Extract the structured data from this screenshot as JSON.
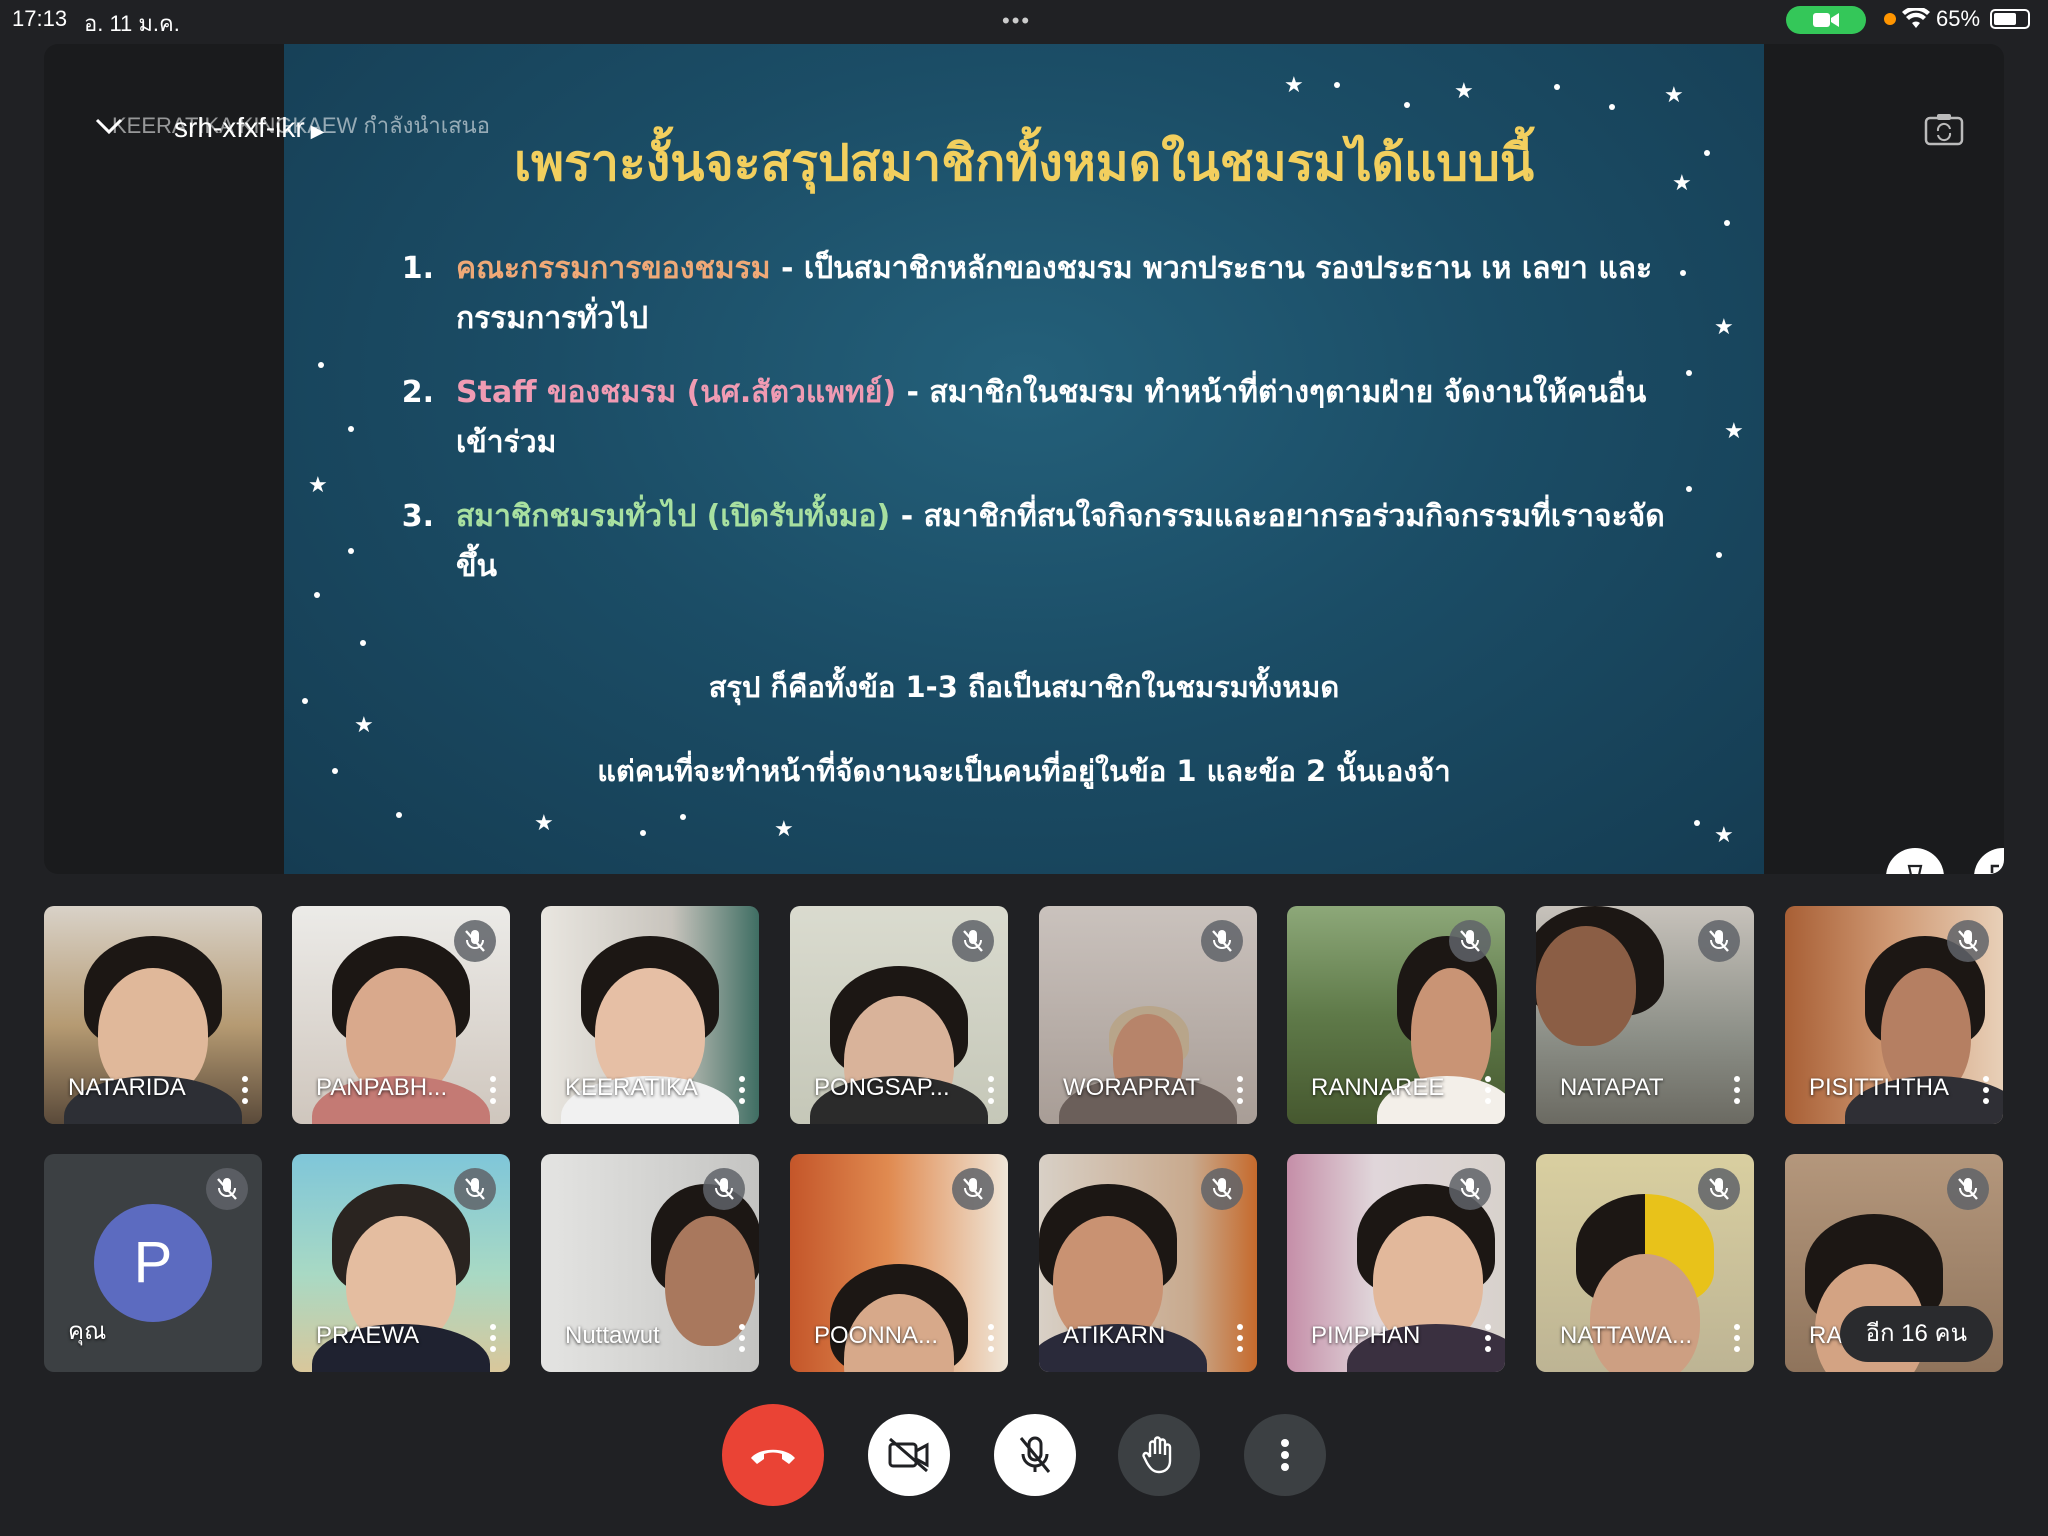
{
  "status_bar": {
    "time": "17:13",
    "date": "อ. 11 ม.ค.",
    "battery": "65%"
  },
  "meeting": {
    "code": "srh-xfxf-ikr",
    "presenter_label": "KEERATIKA KINGKAEW กำลังนำเสนอ"
  },
  "slide": {
    "title": "เพราะงั้นจะสรุปสมาชิกทั้งหมดในชมรมได้แบบนี้",
    "items": [
      {
        "num": "1.",
        "highlight": "คณะกรรมการของชมรม",
        "text": " - เป็นสมาชิกหลักของชมรม พวกประธาน รองประธาน เห เลขา และกรรมการทั่วไป"
      },
      {
        "num": "2.",
        "highlight": "Staff ของชมรม (นศ.สัตวแพทย์)",
        "text": " - สมาชิกในชมรม ทำหน้าที่ต่างๆตามฝ่าย จัดงานให้คนอื่นเข้าร่วม"
      },
      {
        "num": "3.",
        "highlight": "สมาชิกชมรมทั่วไป (เปิดรับทั้งมอ)",
        "text": " - สมาชิกที่สนใจกิจกรรมและอยากรอร่วมกิจกรรมที่เราจะจัดขึ้น"
      }
    ],
    "summary_1": "สรุป ก็คือทั้งข้อ 1-3 ถือเป็นสมาชิกในชมรมทั้งหมด",
    "summary_2": "แต่คนที่จะทำหน้าที่จัดงานจะเป็นคนที่อยู่ในข้อ 1 และข้อ 2 นั้นเองจ้า"
  },
  "participants_row1": [
    {
      "name": "NATARIDA"
    },
    {
      "name": "PANPABH..."
    },
    {
      "name": "KEERATIKA"
    },
    {
      "name": "PONGSAP..."
    },
    {
      "name": "WORAPRAT"
    },
    {
      "name": "RANNAREE"
    },
    {
      "name": "NATAPAT"
    },
    {
      "name": "PISITTHTHA"
    }
  ],
  "participants_row2": [
    {
      "name": "คุณ",
      "avatar_letter": "P"
    },
    {
      "name": "PRAEWA"
    },
    {
      "name": "Nuttawut"
    },
    {
      "name": "POONNA..."
    },
    {
      "name": "ATIKARN"
    },
    {
      "name": "PIMPHAN"
    },
    {
      "name": "NATTAWA..."
    },
    {
      "name": "RAK"
    }
  ],
  "others_count_label": "อีก 16 คน",
  "colors": {
    "end_call": "#ea4335",
    "battery_camera_indicator": "#34c759",
    "avatar": "#5c6bc0",
    "slide_title": "#f2cf5e"
  },
  "icons": {
    "end_call": "phone-hangup-icon",
    "camera": "video-off-icon",
    "microphone": "mic-off-icon",
    "raise_hand": "hand-icon",
    "more": "more-vert-icon"
  }
}
